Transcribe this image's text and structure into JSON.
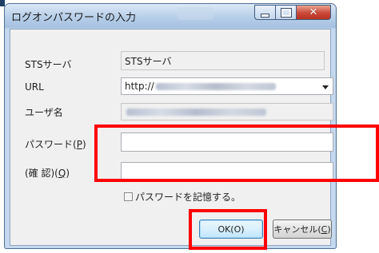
{
  "window": {
    "title": "ログオンパスワードの入力",
    "controls": {
      "minimize": "minimize",
      "maximize": "maximize",
      "close": "close"
    }
  },
  "form": {
    "sts_server": {
      "label": "STSサーバ",
      "value": "STSサーバ"
    },
    "url": {
      "label": "URL",
      "value": "http://"
    },
    "user": {
      "label": "ユーザ名"
    },
    "password": {
      "label_prefix": "パスワード(",
      "label_key": "P",
      "label_suffix": ")",
      "value": ""
    },
    "confirm": {
      "label_prefix": "(確 認)(",
      "label_key": "Q",
      "label_suffix": ")",
      "value": ""
    },
    "remember": {
      "label": "パスワードを記憶する。",
      "checked": false
    }
  },
  "buttons": {
    "ok": "OK(O)",
    "cancel_prefix": "キャンセル(",
    "cancel_key": "C",
    "cancel_suffix": ")"
  },
  "colors": {
    "annotation": "#ff0000",
    "window_frame": "#b9d1ea",
    "close_button": "#c9483a"
  }
}
